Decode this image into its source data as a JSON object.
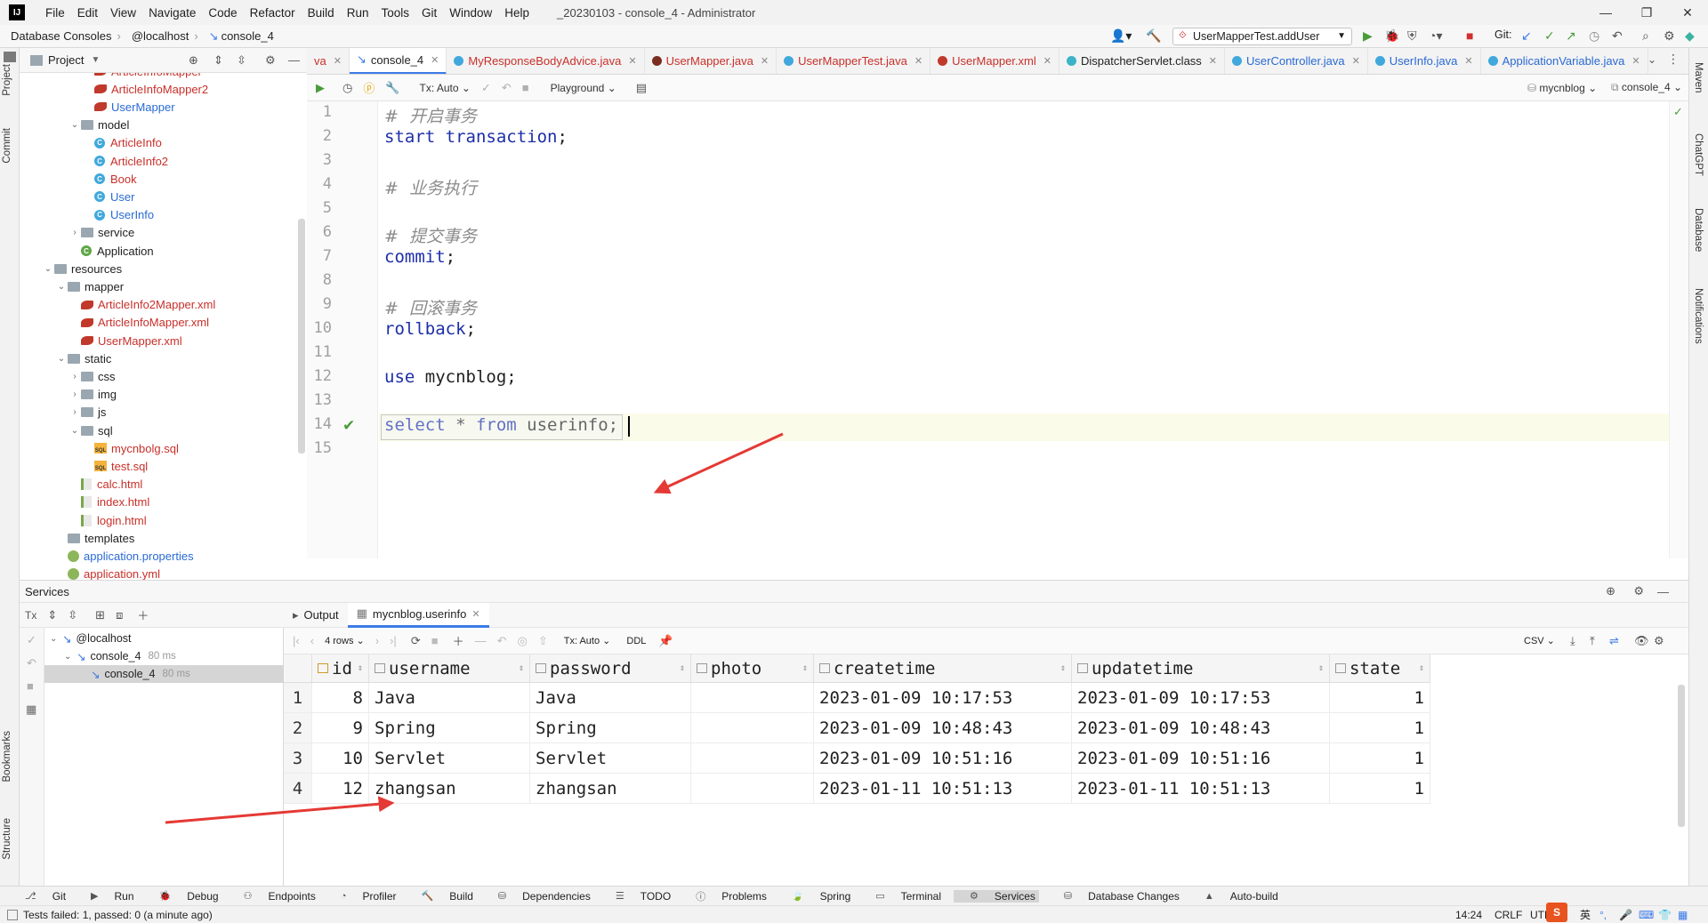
{
  "titlebar": {
    "menu": [
      "File",
      "Edit",
      "View",
      "Navigate",
      "Code",
      "Refactor",
      "Build",
      "Run",
      "Tools",
      "Git",
      "Window",
      "Help"
    ],
    "title": "_20230103 - console_4 - Administrator"
  },
  "navbar": {
    "crumbs": [
      "Database Consoles",
      "@localhost",
      "console_4"
    ],
    "run_config": "UserMapperTest.addUser",
    "git_label": "Git:"
  },
  "left_stripe": {
    "project": "Project",
    "commit": "Commit",
    "bookmarks": "Bookmarks",
    "structure": "Structure"
  },
  "right_stripe": {
    "maven": "Maven",
    "chatgpt": "ChatGPT",
    "database": "Database",
    "notifications": "Notifications"
  },
  "project": {
    "title": "Project",
    "tree": [
      {
        "label": "ArticleInfoMapper",
        "type": "mapper",
        "level": 4,
        "color": "red"
      },
      {
        "label": "ArticleInfoMapper2",
        "type": "mapper",
        "level": 4,
        "color": "red"
      },
      {
        "label": "UserMapper",
        "type": "mapper",
        "level": 4,
        "color": "blue"
      },
      {
        "label": "model",
        "type": "folder",
        "level": 3,
        "open": true
      },
      {
        "label": "ArticleInfo",
        "type": "class",
        "level": 4,
        "color": "red"
      },
      {
        "label": "ArticleInfo2",
        "type": "class",
        "level": 4,
        "color": "red"
      },
      {
        "label": "Book",
        "type": "class",
        "level": 4,
        "color": "red"
      },
      {
        "label": "User",
        "type": "class",
        "level": 4,
        "color": "blue"
      },
      {
        "label": "UserInfo",
        "type": "class",
        "level": 4,
        "color": "blue"
      },
      {
        "label": "service",
        "type": "folder",
        "level": 3,
        "open": false
      },
      {
        "label": "Application",
        "type": "app",
        "level": 3
      },
      {
        "label": "resources",
        "type": "folder",
        "level": 1,
        "open": true
      },
      {
        "label": "mapper",
        "type": "folder",
        "level": 2,
        "open": true
      },
      {
        "label": "ArticleInfo2Mapper.xml",
        "type": "mapper",
        "level": 3,
        "color": "red"
      },
      {
        "label": "ArticleInfoMapper.xml",
        "type": "mapper",
        "level": 3,
        "color": "red"
      },
      {
        "label": "UserMapper.xml",
        "type": "mapper",
        "level": 3,
        "color": "red"
      },
      {
        "label": "static",
        "type": "folder",
        "level": 2,
        "open": true
      },
      {
        "label": "css",
        "type": "folder",
        "level": 3,
        "open": false
      },
      {
        "label": "img",
        "type": "folder",
        "level": 3,
        "open": false
      },
      {
        "label": "js",
        "type": "folder",
        "level": 3,
        "open": false
      },
      {
        "label": "sql",
        "type": "folder",
        "level": 3,
        "open": true
      },
      {
        "label": "mycnbolg.sql",
        "type": "sql",
        "level": 4,
        "color": "red"
      },
      {
        "label": "test.sql",
        "type": "sql",
        "level": 4,
        "color": "red"
      },
      {
        "label": "calc.html",
        "type": "html",
        "level": 3,
        "color": "red"
      },
      {
        "label": "index.html",
        "type": "html",
        "level": 3,
        "color": "red"
      },
      {
        "label": "login.html",
        "type": "html",
        "level": 3,
        "color": "red"
      },
      {
        "label": "templates",
        "type": "folder",
        "level": 2,
        "open": null
      },
      {
        "label": "application.properties",
        "type": "prop",
        "level": 2,
        "color": "blue"
      },
      {
        "label": "application.yml",
        "type": "prop",
        "level": 2,
        "color": "red"
      }
    ]
  },
  "tabs": [
    {
      "label": "va",
      "active": false,
      "color": "red"
    },
    {
      "label": "console_4",
      "active": true
    },
    {
      "label": "MyResponseBodyAdvice.java",
      "active": false,
      "color": "red"
    },
    {
      "label": "UserMapper.java",
      "active": false,
      "color": "red"
    },
    {
      "label": "UserMapperTest.java",
      "active": false,
      "color": "red"
    },
    {
      "label": "UserMapper.xml",
      "active": false,
      "color": "red"
    },
    {
      "label": "DispatcherServlet.class",
      "active": false,
      "color": "dark"
    },
    {
      "label": "UserController.java",
      "active": false,
      "color": "blue"
    },
    {
      "label": "UserInfo.java",
      "active": false,
      "color": "blue"
    },
    {
      "label": "ApplicationVariable.java",
      "active": false,
      "color": "blue"
    }
  ],
  "editor_toolbar": {
    "tx": "Tx: Auto",
    "playground": "Playground",
    "schema": "mycnblog",
    "console": "console_4"
  },
  "code_lines": [
    {
      "n": "1",
      "parts": [
        {
          "t": "#  开启事务",
          "c": "cmt"
        }
      ]
    },
    {
      "n": "2",
      "parts": [
        {
          "t": "start transaction",
          "c": "kw"
        },
        {
          "t": ";",
          "c": "id"
        }
      ]
    },
    {
      "n": "3",
      "parts": []
    },
    {
      "n": "4",
      "parts": [
        {
          "t": "#  业务执行",
          "c": "cmt"
        }
      ]
    },
    {
      "n": "5",
      "parts": []
    },
    {
      "n": "6",
      "parts": [
        {
          "t": "#  提交事务",
          "c": "cmt"
        }
      ]
    },
    {
      "n": "7",
      "parts": [
        {
          "t": "commit",
          "c": "kw"
        },
        {
          "t": ";",
          "c": "id"
        }
      ]
    },
    {
      "n": "8",
      "parts": []
    },
    {
      "n": "9",
      "parts": [
        {
          "t": "#  回滚事务",
          "c": "cmt"
        }
      ]
    },
    {
      "n": "10",
      "parts": [
        {
          "t": "rollback",
          "c": "kw"
        },
        {
          "t": ";",
          "c": "id"
        }
      ]
    },
    {
      "n": "11",
      "parts": []
    },
    {
      "n": "12",
      "parts": [
        {
          "t": "use ",
          "c": "kw"
        },
        {
          "t": "mycnblog;",
          "c": "id"
        }
      ]
    },
    {
      "n": "13",
      "parts": []
    },
    {
      "n": "14",
      "parts": [
        {
          "t": "select ",
          "c": "kw"
        },
        {
          "t": "* ",
          "c": "id"
        },
        {
          "t": "from ",
          "c": "kw"
        },
        {
          "t": "userinfo;",
          "c": "id"
        }
      ]
    },
    {
      "n": "15",
      "parts": []
    }
  ],
  "services": {
    "title": "Services",
    "tree": [
      {
        "label": "@localhost",
        "level": 1,
        "time": ""
      },
      {
        "label": "console_4",
        "level": 2,
        "time": "80 ms"
      },
      {
        "label": "console_4",
        "level": 3,
        "time": "80 ms",
        "selected": true
      }
    ],
    "result_tabs": [
      "Output",
      "mycnblog.userinfo"
    ],
    "grid_toolbar": {
      "rows": "4 rows",
      "tx": "Tx: Auto",
      "ddl": "DDL",
      "csv": "CSV"
    }
  },
  "table": {
    "columns": [
      "id",
      "username",
      "password",
      "photo",
      "createtime",
      "updatetime",
      "state"
    ],
    "rows": [
      {
        "rn": "1",
        "id": "8",
        "username": "Java",
        "password": "Java",
        "photo": "",
        "createtime": "2023-01-09 10:17:53",
        "updatetime": "2023-01-09 10:17:53",
        "state": "1"
      },
      {
        "rn": "2",
        "id": "9",
        "username": "Spring",
        "password": "Spring",
        "photo": "",
        "createtime": "2023-01-09 10:48:43",
        "updatetime": "2023-01-09 10:48:43",
        "state": "1"
      },
      {
        "rn": "3",
        "id": "10",
        "username": "Servlet",
        "password": "Servlet",
        "photo": "",
        "createtime": "2023-01-09 10:51:16",
        "updatetime": "2023-01-09 10:51:16",
        "state": "1"
      },
      {
        "rn": "4",
        "id": "12",
        "username": "zhangsan",
        "password": "zhangsan",
        "photo": "",
        "createtime": "2023-01-11 10:51:13",
        "updatetime": "2023-01-11 10:51:13",
        "state": "1"
      }
    ]
  },
  "bottom_tools": [
    "Git",
    "Run",
    "Debug",
    "Endpoints",
    "Profiler",
    "Build",
    "Dependencies",
    "TODO",
    "Problems",
    "Spring",
    "Terminal",
    "Services",
    "Database Changes",
    "Auto-build"
  ],
  "status": {
    "message": "Tests failed: 1, passed: 0 (a minute ago)",
    "position": "14:24",
    "line_sep": "CRLF",
    "encoding": "UTF",
    "ime": "英"
  },
  "colors": {
    "accent": "#3d7be8",
    "keyword": "#1d2ea8",
    "comment": "#8c8c8c",
    "arrow": "#e53935",
    "changed": "#c8302a",
    "modified": "#2a6ad3"
  }
}
